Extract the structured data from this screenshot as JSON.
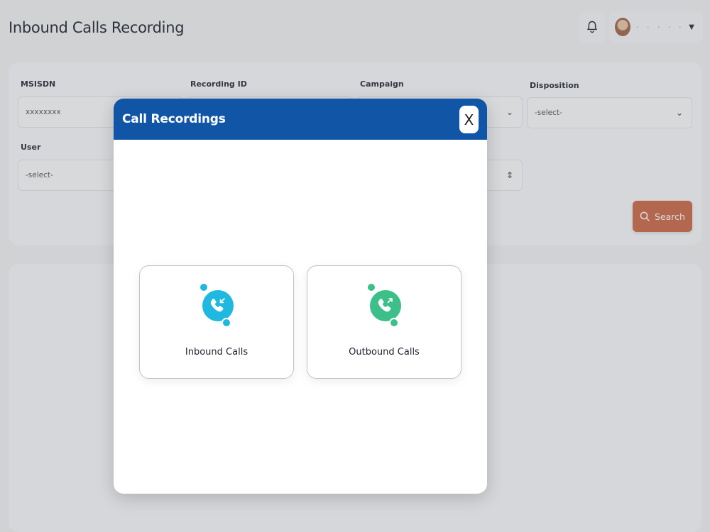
{
  "header": {
    "title": "Inbound Calls Recording",
    "profile_name": "· · · · ·",
    "bell_icon": "bell-icon",
    "chevron_icon": "chevron-down-icon"
  },
  "filters": {
    "msisdn": {
      "label": "MSISDN",
      "value": "xxxxxxxx"
    },
    "recording_id": {
      "label": "Recording ID",
      "value": ""
    },
    "campaign": {
      "label": "Campaign",
      "value": ""
    },
    "disposition": {
      "label": "Disposition",
      "value": "-select-"
    },
    "user": {
      "label": "User",
      "value": "-select-"
    },
    "search_label": "Search"
  },
  "modal": {
    "title": "Call Recordings",
    "close_label": "X",
    "options": [
      {
        "label": "Inbound Calls",
        "icon": "incoming-call-icon",
        "color": "#1fb8e0"
      },
      {
        "label": "Outbound Calls",
        "icon": "outgoing-call-icon",
        "color": "#3dbf8a"
      }
    ]
  },
  "colors": {
    "modal_header": "#1155a6",
    "search_button": "#cc6a47"
  }
}
